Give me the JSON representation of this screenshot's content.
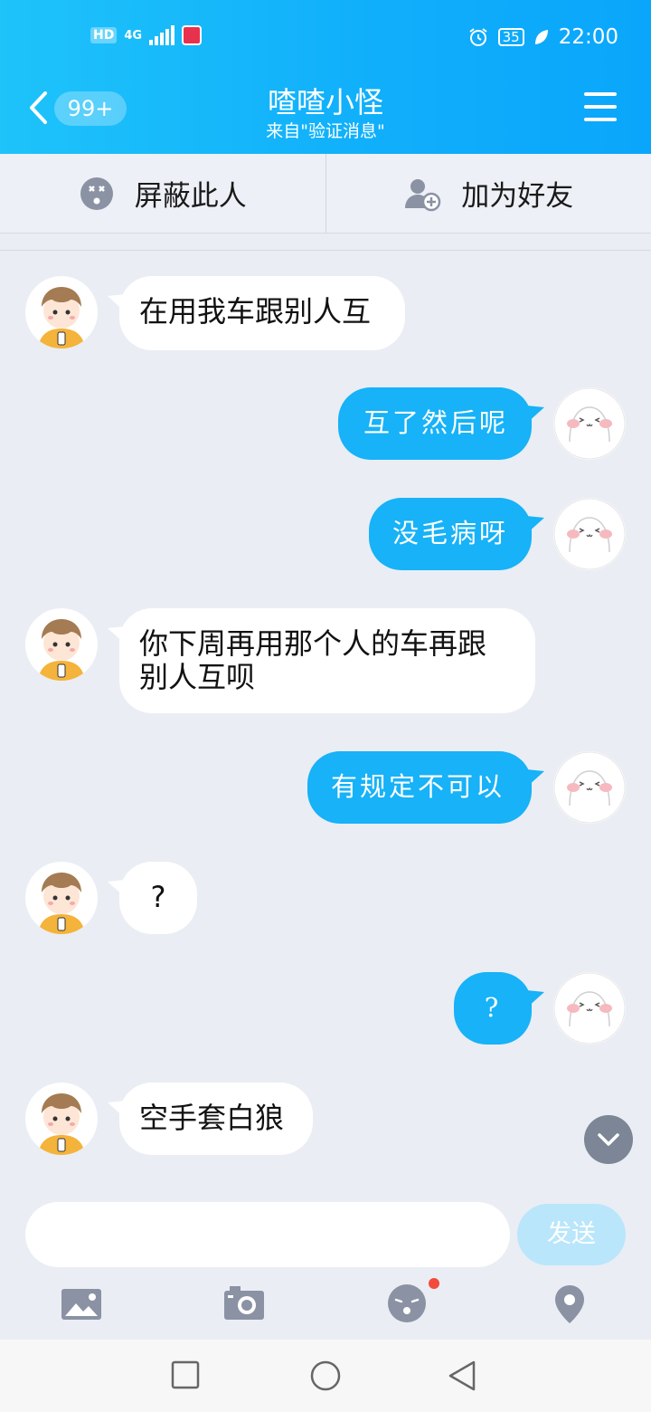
{
  "status_bar": {
    "hd": "HD",
    "network": "4G",
    "battery": "35",
    "time": "22:00"
  },
  "header": {
    "unread_badge": "99+",
    "title": "喳喳小怪",
    "subtitle": "来自\"验证消息\""
  },
  "actions": {
    "block_label": "屏蔽此人",
    "add_friend_label": "加为好友"
  },
  "messages": [
    {
      "side": "incoming",
      "text": "在用我车跟别人互"
    },
    {
      "side": "outgoing",
      "text": "互了然后呢"
    },
    {
      "side": "outgoing",
      "text": "没毛病呀"
    },
    {
      "side": "incoming",
      "text": "你下周再用那个人的车再跟别人互呗"
    },
    {
      "side": "outgoing",
      "text": "有规定不可以"
    },
    {
      "side": "incoming",
      "text": "?"
    },
    {
      "side": "outgoing",
      "text": "?"
    },
    {
      "side": "incoming",
      "text": "空手套白狼"
    }
  ],
  "composer": {
    "input_value": "",
    "send_label": "发送"
  },
  "toolbar": [
    "image-icon",
    "camera-icon",
    "emoji-icon",
    "location-icon"
  ],
  "colors": {
    "header": "#10aefb",
    "outgoing_bubble": "#17b2f7",
    "incoming_bubble": "#ffffff",
    "background": "#eaedf4"
  }
}
